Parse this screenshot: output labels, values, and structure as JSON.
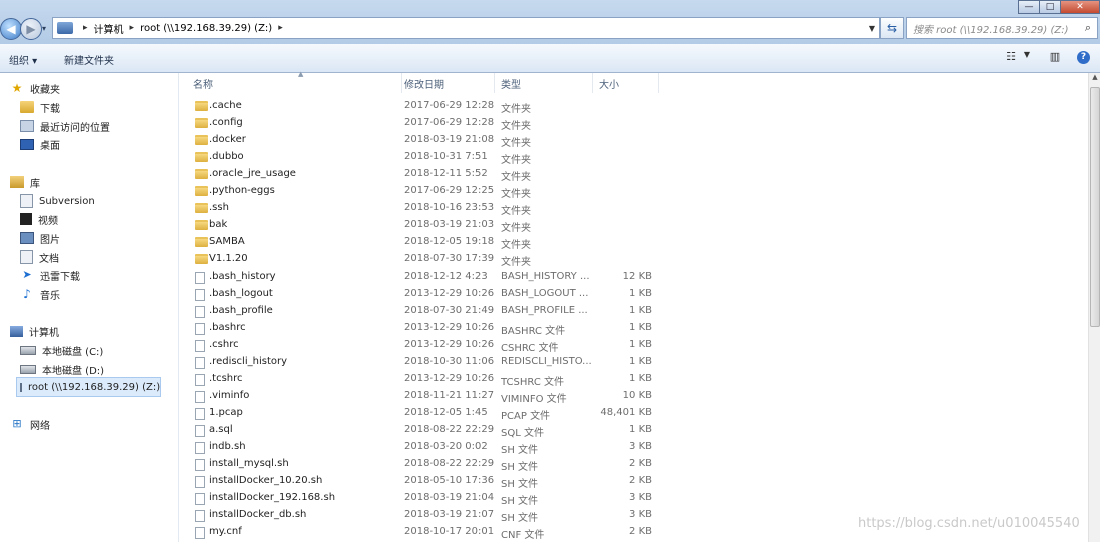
{
  "window": {
    "controls": [
      "—",
      "□",
      "✕"
    ]
  },
  "address_bar": {
    "segments": [
      "计算机",
      "root (\\\\192.168.39.29) (Z:)"
    ],
    "search_placeholder": "搜索 root (\\\\192.168.39.29) (Z:)"
  },
  "toolbar": {
    "organize": "组织 ▾",
    "new_folder": "新建文件夹"
  },
  "nav": {
    "favorites": {
      "label": "收藏夹",
      "items": [
        "下载",
        "最近访问的位置",
        "桌面"
      ]
    },
    "libraries": {
      "label": "库",
      "items": [
        "Subversion",
        "视频",
        "图片",
        "文档",
        "迅雷下载",
        "音乐"
      ]
    },
    "computer": {
      "label": "计算机",
      "items": [
        "本地磁盘 (C:)",
        "本地磁盘 (D:)",
        "root (\\\\192.168.39.29) (Z:)"
      ]
    },
    "network": {
      "label": "网络"
    }
  },
  "columns": {
    "name": "名称",
    "date": "修改日期",
    "type": "类型",
    "size": "大小"
  },
  "files": [
    {
      "name": ".cache",
      "date": "2017-06-29 12:28",
      "type": "文件夹",
      "size": "",
      "kind": "folder"
    },
    {
      "name": ".config",
      "date": "2017-06-29 12:28",
      "type": "文件夹",
      "size": "",
      "kind": "folder"
    },
    {
      "name": ".docker",
      "date": "2018-03-19 21:08",
      "type": "文件夹",
      "size": "",
      "kind": "folder"
    },
    {
      "name": ".dubbo",
      "date": "2018-10-31 7:51",
      "type": "文件夹",
      "size": "",
      "kind": "folder"
    },
    {
      "name": ".oracle_jre_usage",
      "date": "2018-12-11 5:52",
      "type": "文件夹",
      "size": "",
      "kind": "folder"
    },
    {
      "name": ".python-eggs",
      "date": "2017-06-29 12:25",
      "type": "文件夹",
      "size": "",
      "kind": "folder"
    },
    {
      "name": ".ssh",
      "date": "2018-10-16 23:53",
      "type": "文件夹",
      "size": "",
      "kind": "folder"
    },
    {
      "name": "bak",
      "date": "2018-03-19 21:03",
      "type": "文件夹",
      "size": "",
      "kind": "folder"
    },
    {
      "name": "SAMBA",
      "date": "2018-12-05 19:18",
      "type": "文件夹",
      "size": "",
      "kind": "folder"
    },
    {
      "name": "V1.1.20",
      "date": "2018-07-30 17:39",
      "type": "文件夹",
      "size": "",
      "kind": "folder"
    },
    {
      "name": ".bash_history",
      "date": "2018-12-12 4:23",
      "type": "BASH_HISTORY ...",
      "size": "12 KB",
      "kind": "file"
    },
    {
      "name": ".bash_logout",
      "date": "2013-12-29 10:26",
      "type": "BASH_LOGOUT ...",
      "size": "1 KB",
      "kind": "file"
    },
    {
      "name": ".bash_profile",
      "date": "2018-07-30 21:49",
      "type": "BASH_PROFILE ...",
      "size": "1 KB",
      "kind": "file"
    },
    {
      "name": ".bashrc",
      "date": "2013-12-29 10:26",
      "type": "BASHRC 文件",
      "size": "1 KB",
      "kind": "file"
    },
    {
      "name": ".cshrc",
      "date": "2013-12-29 10:26",
      "type": "CSHRC 文件",
      "size": "1 KB",
      "kind": "file"
    },
    {
      "name": ".rediscli_history",
      "date": "2018-10-30 11:06",
      "type": "REDISCLI_HISTO...",
      "size": "1 KB",
      "kind": "file"
    },
    {
      "name": ".tcshrc",
      "date": "2013-12-29 10:26",
      "type": "TCSHRC 文件",
      "size": "1 KB",
      "kind": "file"
    },
    {
      "name": ".viminfo",
      "date": "2018-11-21 11:27",
      "type": "VIMINFO 文件",
      "size": "10 KB",
      "kind": "file"
    },
    {
      "name": "1.pcap",
      "date": "2018-12-05 1:45",
      "type": "PCAP 文件",
      "size": "48,401 KB",
      "kind": "file"
    },
    {
      "name": "a.sql",
      "date": "2018-08-22 22:29",
      "type": "SQL 文件",
      "size": "1 KB",
      "kind": "file"
    },
    {
      "name": "indb.sh",
      "date": "2018-03-20 0:02",
      "type": "SH 文件",
      "size": "3 KB",
      "kind": "file"
    },
    {
      "name": "install_mysql.sh",
      "date": "2018-08-22 22:29",
      "type": "SH 文件",
      "size": "2 KB",
      "kind": "file"
    },
    {
      "name": "installDocker_10.20.sh",
      "date": "2018-05-10 17:36",
      "type": "SH 文件",
      "size": "2 KB",
      "kind": "file"
    },
    {
      "name": "installDocker_192.168.sh",
      "date": "2018-03-19 21:04",
      "type": "SH 文件",
      "size": "3 KB",
      "kind": "file"
    },
    {
      "name": "installDocker_db.sh",
      "date": "2018-03-19 21:07",
      "type": "SH 文件",
      "size": "3 KB",
      "kind": "file"
    },
    {
      "name": "my.cnf",
      "date": "2018-10-17 20:01",
      "type": "CNF 文件",
      "size": "2 KB",
      "kind": "file"
    }
  ],
  "watermark": "https://blog.csdn.net/u010045540"
}
